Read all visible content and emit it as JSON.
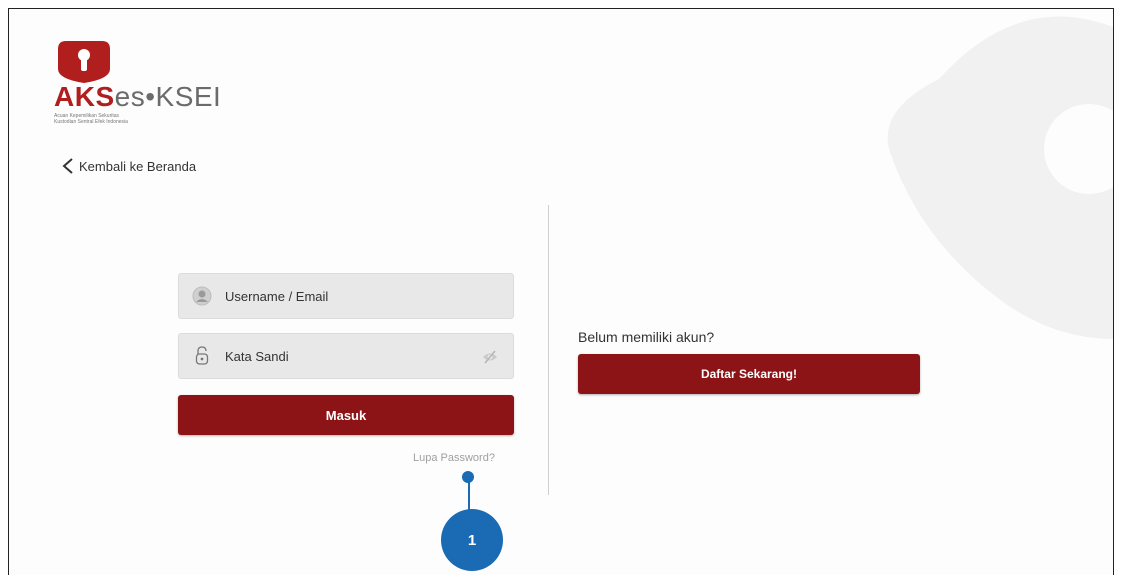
{
  "logo": {
    "brand_aks": "AKS",
    "brand_es": "es",
    "brand_sep": "•",
    "brand_ksei": "KSEI",
    "subline1": "Acuan Kepemilikan Sekuritas",
    "subline2": "Kustodian Sentral Efek Indonesia",
    "accent_color": "#b11e1e"
  },
  "nav": {
    "back_label": "Kembali ke Beranda",
    "back_icon": "chevron-left-icon"
  },
  "login": {
    "username_placeholder": "Username / Email",
    "username_icon": "user-avatar-icon",
    "password_placeholder": "Kata Sandi",
    "password_icon": "lock-icon",
    "toggle_icon": "eye-hidden-icon",
    "submit_label": "Masuk",
    "forgot_label": "Lupa Password?",
    "button_color": "#8d1416"
  },
  "signup": {
    "prompt": "Belum memiliki akun?",
    "button_label": "Daftar Sekarang!"
  },
  "annotation": {
    "badge_number": "1",
    "color": "#1a6bb3"
  }
}
